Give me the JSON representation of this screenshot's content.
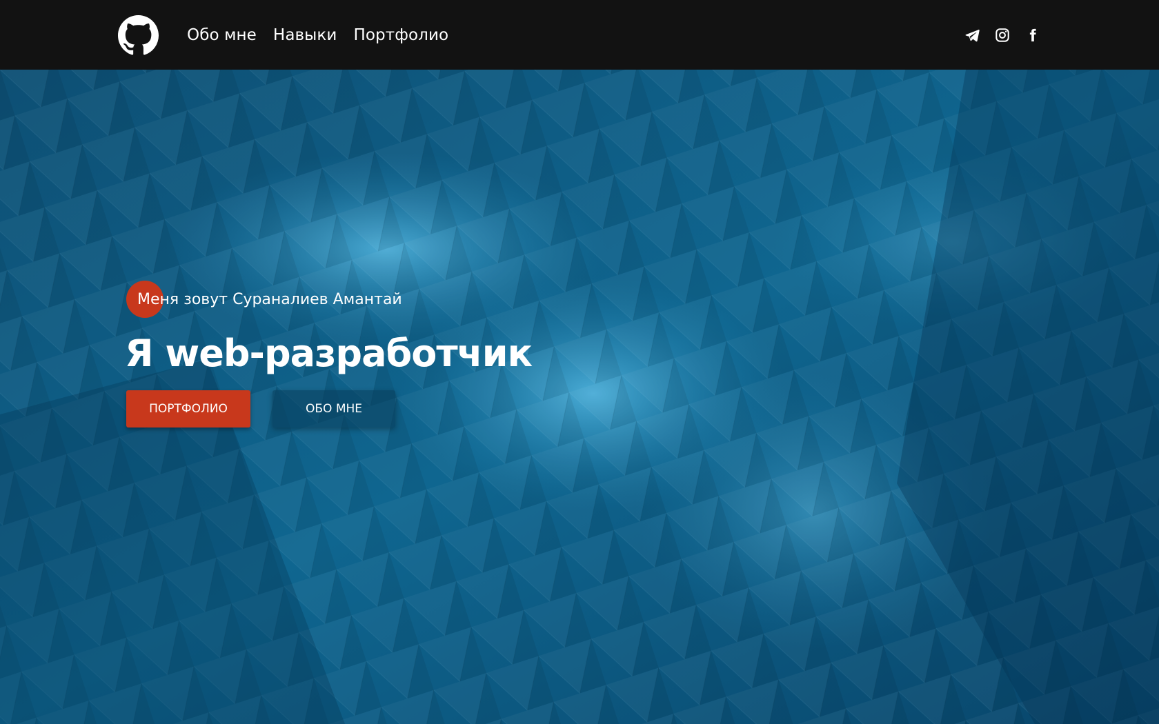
{
  "header": {
    "logo": "github-icon",
    "nav": [
      {
        "label": "Обо мне"
      },
      {
        "label": "Навыки"
      },
      {
        "label": "Портфолио"
      }
    ],
    "socials": [
      "telegram-icon",
      "instagram-icon",
      "facebook-icon"
    ]
  },
  "hero": {
    "greeting": "Меня зовут Сураналиев Амантай",
    "title": "Я web-разработчик",
    "primary_button": "ПОРТФОЛИО",
    "secondary_button": "ОБО МНЕ"
  },
  "colors": {
    "header_bg": "#121212",
    "accent": "#c8381c",
    "hero_bg": "#0b4a6e"
  }
}
